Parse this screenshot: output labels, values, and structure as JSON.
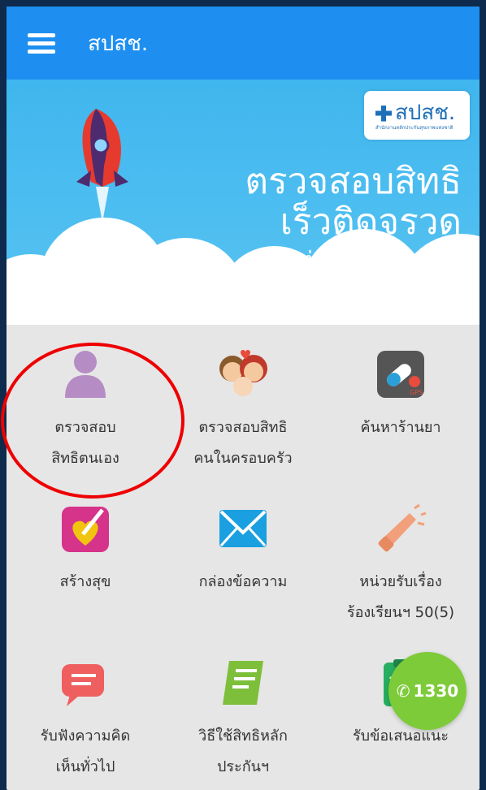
{
  "app": {
    "title": "สปสช."
  },
  "banner": {
    "logo_text": "สปสช.",
    "logo_sub": "สำนักงานหลักประกันสุขภาพแห่งชาติ",
    "line1": "ตรวจสอบสิทธิ",
    "line2": "เร็วติดจรวด",
    "line3": "ง่ายแค่ปลายนิ้ว"
  },
  "tiles": [
    {
      "lines": [
        "ตรวจสอบ",
        "สิทธิตนเอง"
      ],
      "icon": "user-icon"
    },
    {
      "lines": [
        "ตรวจสอบสิทธิ",
        "คนในครอบครัว"
      ],
      "icon": "family-icon"
    },
    {
      "lines": [
        "ค้นหาร้านยา"
      ],
      "icon": "pill-gps-icon"
    },
    {
      "lines": [
        "สร้างสุข"
      ],
      "icon": "heart-check-icon"
    },
    {
      "lines": [
        "กล่องข้อความ"
      ],
      "icon": "envelope-icon"
    },
    {
      "lines": [
        "หน่วยรับเรื่อง",
        "ร้องเรียนฯ 50(5)"
      ],
      "icon": "megaphone-icon"
    },
    {
      "lines": [
        "รับฟังความคิด",
        "เห็นทั่วไป"
      ],
      "icon": "chat-bubble-icon"
    },
    {
      "lines": [
        "วิธีใช้สิทธิหลัก",
        "ประกันฯ"
      ],
      "icon": "book-icon"
    },
    {
      "lines": [
        "รับข้อเสนอแนะ"
      ],
      "icon": "clipboard-icon"
    }
  ],
  "call": {
    "label": "1330",
    "icon": "phone-icon"
  },
  "colors": {
    "appbar": "#1e8ff0",
    "banner": "#40b6ee",
    "fab": "#7ecb3a",
    "annotation": "#e00000"
  }
}
